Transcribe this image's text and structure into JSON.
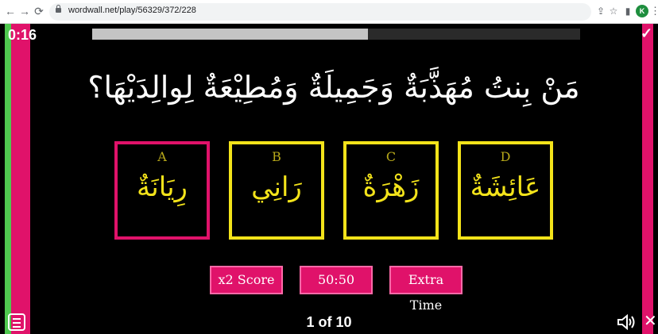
{
  "browser": {
    "url": "wordwall.net/play/56329/372/228",
    "avatar_letter": "K",
    "icons": [
      "back-icon",
      "forward-icon",
      "reload-icon",
      "share-icon",
      "star-icon",
      "sidebar-icon",
      "avatar",
      "menu-dots-icon"
    ]
  },
  "game": {
    "timer": "0:16",
    "progress_fraction": 0.565,
    "question": "مَنْ بِنتُ مُهَذَّبَةٌ وَجَمِيلَةٌ وَمُطِيْعَةٌ لِوالِدَيْهَا؟",
    "answers": [
      {
        "letter": "A",
        "text": "رِيَانَةٌ",
        "highlight": "red"
      },
      {
        "letter": "B",
        "text": "رَانِي",
        "highlight": "yellow"
      },
      {
        "letter": "C",
        "text": "زَهْرَةٌ",
        "highlight": "yellow"
      },
      {
        "letter": "D",
        "text": "عَائِشَةٌ",
        "highlight": "yellow"
      }
    ],
    "powerups": {
      "double_score": "x2 Score",
      "fifty_fifty": "50:50",
      "extra_time": "Extra Time"
    },
    "counter": "1 of 10"
  },
  "colors": {
    "accent_pink": "#e0126a",
    "accent_yellow": "#f3e31a",
    "side_green": "#4fc84f"
  }
}
